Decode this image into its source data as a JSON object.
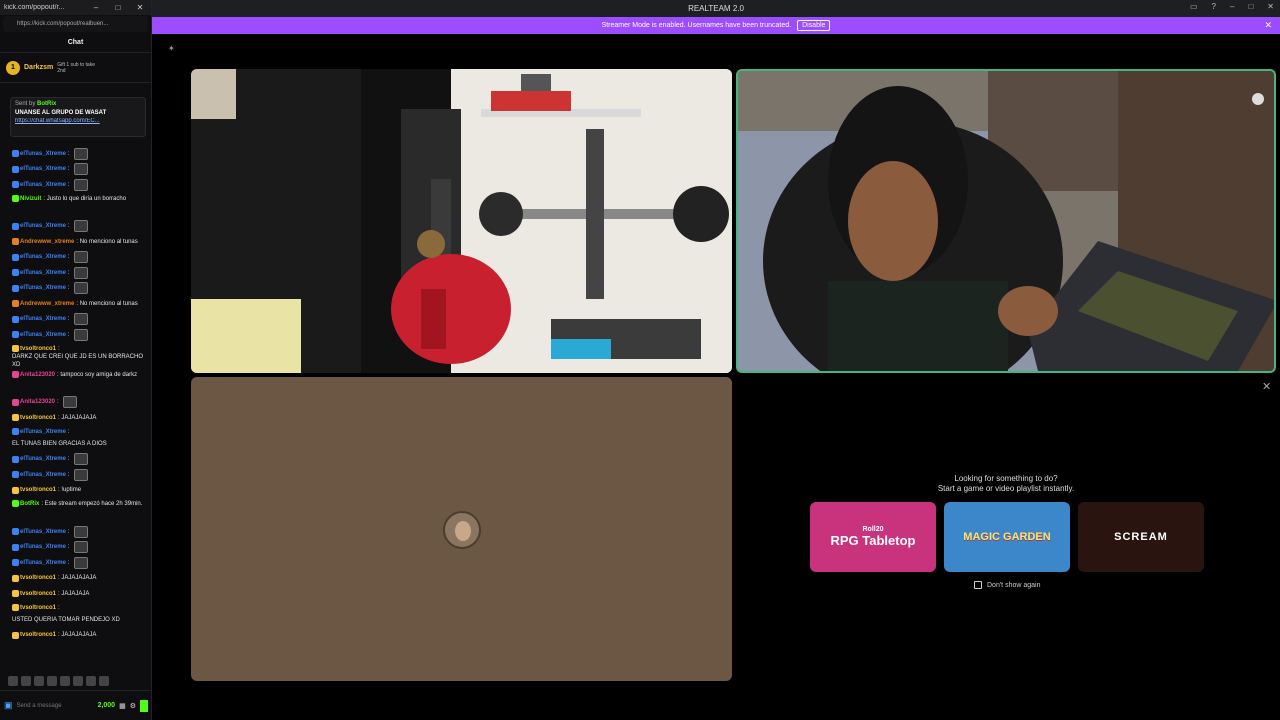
{
  "chat_window": {
    "title": "kick.com/popout/r...",
    "url": "https://kick.com/popout/realbuen...",
    "header": "Chat",
    "gift": {
      "user": "Darkzsm",
      "text_line1": "Gift 1 sub to take",
      "text_line2": "2nd"
    },
    "pinned": {
      "sent_by_label": "Sent by",
      "sent_by_user": "BotRix",
      "message": "UNANSE AL GRUPO DE WASAT",
      "link": "https://chat.whatsapp.com/EC..."
    },
    "messages": [
      {
        "user": "elTunas_Xtreme",
        "color": "#3b82f6",
        "text": "",
        "emote": true
      },
      {
        "user": "elTunas_Xtreme",
        "color": "#3b82f6",
        "text": "",
        "emote": true
      },
      {
        "user": "elTunas_Xtreme",
        "color": "#3b82f6",
        "text": "",
        "emote": true
      },
      {
        "user": "Nivizuit",
        "color": "#53fc18",
        "text": "Justo lo que diría un borracho",
        "emote": false
      },
      {
        "user": "elTunas_Xtreme",
        "color": "#3b82f6",
        "text": "",
        "emote": true
      },
      {
        "user": "Andrewww_xtreme",
        "color": "#e67e22",
        "text": "No menciono al tunas",
        "emote": false
      },
      {
        "user": "elTunas_Xtreme",
        "color": "#3b82f6",
        "text": "",
        "emote": true
      },
      {
        "user": "elTunas_Xtreme",
        "color": "#3b82f6",
        "text": "",
        "emote": true
      },
      {
        "user": "elTunas_Xtreme",
        "color": "#3b82f6",
        "text": "",
        "emote": true
      },
      {
        "user": "Andrewww_xtreme",
        "color": "#e67e22",
        "text": "No menciono al tunas",
        "emote": false
      },
      {
        "user": "elTunas_Xtreme",
        "color": "#3b82f6",
        "text": "",
        "emote": true
      },
      {
        "user": "elTunas_Xtreme",
        "color": "#3b82f6",
        "text": "",
        "emote": true
      },
      {
        "user": "tvsoltronco1",
        "color": "#f5c542",
        "text": "DARKZ QUE CREI QUE JD ES UN BORRACHO XD",
        "emote": false
      },
      {
        "user": "Anita123020",
        "color": "#e84393",
        "text": "tampoco soy amiga de darkz",
        "emote": false
      },
      {
        "user": "Anita123020",
        "color": "#e84393",
        "text": "",
        "emote": true
      },
      {
        "user": "tvsoltronco1",
        "color": "#f5c542",
        "text": "JAJAJAJAJA",
        "emote": false
      },
      {
        "user": "elTunas_Xtreme",
        "color": "#3b82f6",
        "text": "EL TUNAS BIEN GRACIAS A DIOS",
        "emote": false
      },
      {
        "user": "elTunas_Xtreme",
        "color": "#3b82f6",
        "text": "",
        "emote": true
      },
      {
        "user": "elTunas_Xtreme",
        "color": "#3b82f6",
        "text": "",
        "emote": true
      },
      {
        "user": "tvsoltronco1",
        "color": "#f5c542",
        "text": "!uptime",
        "emote": false
      },
      {
        "user": "BotRix",
        "color": "#53fc18",
        "text": "Este stream empezó hace 2h 39min.",
        "emote": false
      },
      {
        "user": "elTunas_Xtreme",
        "color": "#3b82f6",
        "text": "",
        "emote": true
      },
      {
        "user": "elTunas_Xtreme",
        "color": "#3b82f6",
        "text": "",
        "emote": true
      },
      {
        "user": "elTunas_Xtreme",
        "color": "#3b82f6",
        "text": "",
        "emote": true
      },
      {
        "user": "tvsoltronco1",
        "color": "#f5c542",
        "text": "JAJAJAJAJA",
        "emote": false
      },
      {
        "user": "tvsoltronco1",
        "color": "#f5c542",
        "text": "JAJAJAJA",
        "emote": false
      },
      {
        "user": "tvsoltronco1",
        "color": "#f5c542",
        "text": "USTED QUERIA TOMAR PENDEJO XD",
        "emote": false
      },
      {
        "user": "tvsoltronco1",
        "color": "#f5c542",
        "text": "JAJAJAJAJA",
        "emote": false
      }
    ],
    "input_placeholder": "Send a message",
    "points": "2,000"
  },
  "app": {
    "title": "REALTEAM 2.0",
    "banner_text": "Streamer Mode is enabled. Usernames have been truncated.",
    "banner_button": "Disable",
    "promo": {
      "title_line1": "Looking for something to do?",
      "title_line2": "Start a game or video playlist instantly.",
      "cards": [
        {
          "sub": "Roll20",
          "title": "RPG Tabletop"
        },
        {
          "title": "MAGIC GARDEN"
        },
        {
          "title": "SCREAM"
        }
      ],
      "dont_show": "Don't show again"
    }
  }
}
